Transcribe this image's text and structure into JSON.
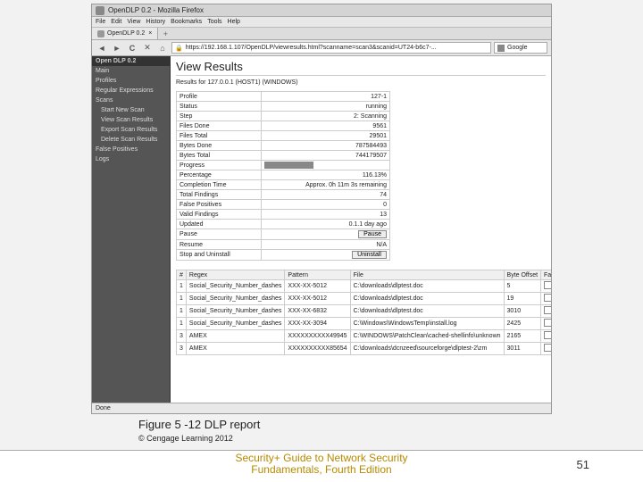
{
  "browser": {
    "title": "OpenDLP 0.2 - Mozilla Firefox",
    "menu": [
      "File",
      "Edit",
      "View",
      "History",
      "Bookmarks",
      "Tools",
      "Help"
    ],
    "tab_label": "OpenDLP 0.2",
    "url": "https://192.168.1.107/OpenDLP/viewresults.html?scanname=scan3&scanid=UT24-b6c7-...",
    "search_placeholder": "Google",
    "status": "Done"
  },
  "sidebar": {
    "logo": "Open DLP 0.2",
    "items": [
      {
        "label": "Main",
        "sub": false
      },
      {
        "label": "Profiles",
        "sub": false
      },
      {
        "label": "Regular Expressions",
        "sub": false
      },
      {
        "label": "Scans",
        "sub": false
      },
      {
        "label": "Start New Scan",
        "sub": true
      },
      {
        "label": "View Scan Results",
        "sub": true
      },
      {
        "label": "Export Scan Results",
        "sub": true
      },
      {
        "label": "Delete Scan Results",
        "sub": true
      },
      {
        "label": "False Positives",
        "sub": false
      },
      {
        "label": "Logs",
        "sub": false
      }
    ]
  },
  "page": {
    "heading": "View Results",
    "subtitle": "Results for 127.0.0.1 (HOST1) (WINDOWS)"
  },
  "stats": [
    {
      "k": "Profile",
      "v": "127-1"
    },
    {
      "k": "Status",
      "v": "running"
    },
    {
      "k": "Step",
      "v": "2: Scanning"
    },
    {
      "k": "Files Done",
      "v": "9561"
    },
    {
      "k": "Files Total",
      "v": "29501"
    },
    {
      "k": "Bytes Done",
      "v": "787584493"
    },
    {
      "k": "Bytes Total",
      "v": "744179507"
    },
    {
      "k": "Progress",
      "v": ""
    },
    {
      "k": "Percentage",
      "v": "116.13%"
    },
    {
      "k": "Completion Time",
      "v": "Approx. 0h 11m 3s remaining"
    },
    {
      "k": "Total Findings",
      "v": "74"
    },
    {
      "k": "False Positives",
      "v": "0"
    },
    {
      "k": "Valid Findings",
      "v": "13"
    },
    {
      "k": "Updated",
      "v": "0.1.1 day ago"
    },
    {
      "k": "Pause",
      "v": ""
    },
    {
      "k": "Resume",
      "v": "N/A"
    },
    {
      "k": "Stop and Uninstall",
      "v": ""
    }
  ],
  "stat_buttons": {
    "pause": "Pause",
    "uninstall": "Uninstall"
  },
  "results": {
    "headers": [
      "#",
      "Regex",
      "Pattern",
      "File",
      "Byte Offset",
      "False?"
    ],
    "rows": [
      {
        "n": "1",
        "regex": "Social_Security_Number_dashes",
        "pat": "XXX-XX-5012",
        "file": "C:\\downloads\\dlptest.doc",
        "off": "5",
        "f": ""
      },
      {
        "n": "1",
        "regex": "Social_Security_Number_dashes",
        "pat": "XXX-XX-5012",
        "file": "C:\\downloads\\dlptest.doc",
        "off": "19",
        "f": ""
      },
      {
        "n": "1",
        "regex": "Social_Security_Number_dashes",
        "pat": "XXX-XX-6832",
        "file": "C:\\downloads\\dlptest.doc",
        "off": "3010",
        "f": ""
      },
      {
        "n": "1",
        "regex": "Social_Security_Number_dashes",
        "pat": "XXX-XX-3094",
        "file": "C:\\Windows\\WindowsTemp\\install.log",
        "off": "2425",
        "f": ""
      },
      {
        "n": "3",
        "regex": "AMEX",
        "pat": "XXXXXXXXXX49945",
        "file": "C:\\WINDOWS\\PatchClean\\cached-shellinfo\\unknown",
        "off": "2165",
        "f": ""
      },
      {
        "n": "3",
        "regex": "AMEX",
        "pat": "XXXXXXXXXX85654",
        "file": "C:\\downloads\\dcnzeed\\sourceforge\\dlptest-2\\zm",
        "off": "3011",
        "f": ""
      }
    ]
  },
  "caption": "Figure 5 -12 DLP report",
  "copyright": "© Cengage Learning 2012",
  "book": "Security+ Guide to Network Security Fundamentals, Fourth Edition",
  "page_number": "51"
}
